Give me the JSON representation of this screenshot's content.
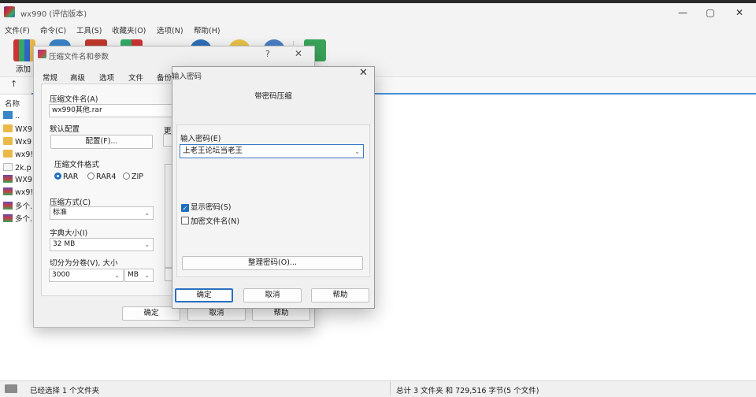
{
  "app": {
    "title": "wx990 (评估版本)",
    "window_controls": {
      "minimize": "—",
      "maximize": "▢",
      "close": "✕"
    }
  },
  "menu": [
    "文件(F)",
    "命令(C)",
    "工具(S)",
    "收藏夹(O)",
    "选项(N)",
    "帮助(H)"
  ],
  "toolbar": {
    "add_label": "添加",
    "icons": [
      "add-icon",
      "folder-icon",
      "test-icon",
      "view-icon",
      "info-icon",
      "wizard-icon",
      "find-icon",
      "sfx-icon"
    ]
  },
  "address": {
    "up": "↑"
  },
  "file_list": {
    "column_name": "名称",
    "rows": [
      {
        "icon": "up",
        "name": ".."
      },
      {
        "icon": "folder",
        "name": "WX9"
      },
      {
        "icon": "folder",
        "name": "Wx9"
      },
      {
        "icon": "folder",
        "name": "wx9!"
      },
      {
        "icon": "file",
        "name": "2k.p"
      },
      {
        "icon": "rar",
        "name": "WX9"
      },
      {
        "icon": "rar",
        "name": "wx9!"
      },
      {
        "icon": "rar",
        "name": "多个..."
      },
      {
        "icon": "rar",
        "name": "多个..."
      }
    ]
  },
  "status": {
    "left": "已经选择 1 个文件夹",
    "right": "总计 3 文件夹 和 729,516 字节(5 个文件)"
  },
  "archive_dialog": {
    "title": "压缩文件名和参数",
    "help": "?",
    "close": "✕",
    "tabs": [
      "常规",
      "高级",
      "选项",
      "文件",
      "备份"
    ],
    "archive_name_label": "压缩文件名(A)",
    "archive_name_value": "wx990其他.rar",
    "profile_label": "默认配置",
    "profile_button": "配置(F)...",
    "right_label": "更",
    "format_label": "压缩文件格式",
    "formats": [
      "RAR",
      "RAR4",
      "ZIP"
    ],
    "selected_format": "RAR",
    "method_label": "压缩方式(C)",
    "method_value": "标准",
    "dict_label": "字典大小(I)",
    "dict_value": "32 MB",
    "split_label": "切分为分卷(V), 大小",
    "split_value": "3000",
    "split_unit": "MB",
    "buttons": {
      "ok": "确定",
      "cancel": "取消",
      "help": "帮助"
    }
  },
  "password_dialog": {
    "title": "输入密码",
    "close": "✕",
    "heading": "带密码压缩",
    "password_label": "输入密码(E)",
    "password_value": "上老王论坛当老王",
    "show_password_label": "显示密码(S)",
    "show_password_checked": true,
    "encrypt_names_label": "加密文件名(N)",
    "encrypt_names_checked": false,
    "organize_button": "整理密码(O)...",
    "buttons": {
      "ok": "确定",
      "cancel": "取消",
      "help": "帮助"
    }
  }
}
